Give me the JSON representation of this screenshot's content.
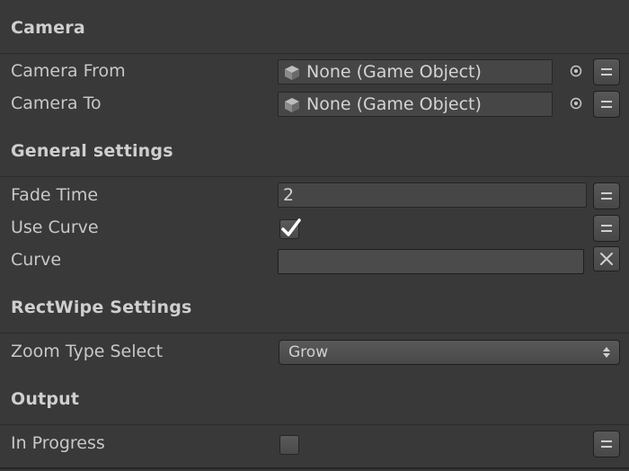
{
  "sections": {
    "camera": {
      "title": "Camera"
    },
    "general": {
      "title": "General settings"
    },
    "rectwipe": {
      "title": "RectWipe Settings"
    },
    "output": {
      "title": "Output"
    }
  },
  "fields": {
    "camera_from": {
      "label": "Camera From",
      "value": "None (Game Object)",
      "icon": "gameobject-cube-icon"
    },
    "camera_to": {
      "label": "Camera To",
      "value": "None (Game Object)",
      "icon": "gameobject-cube-icon"
    },
    "fade_time": {
      "label": "Fade Time",
      "value": "2"
    },
    "use_curve": {
      "label": "Use Curve",
      "checked": true
    },
    "curve": {
      "label": "Curve"
    },
    "zoom_type": {
      "label": "Zoom Type Select",
      "value": "Grow"
    },
    "in_progress": {
      "label": "In Progress",
      "checked": false
    }
  },
  "colors": {
    "background": "#393939",
    "field_bg": "#464646",
    "text": "#c8c8c8",
    "header_text": "#cfcfcf"
  }
}
